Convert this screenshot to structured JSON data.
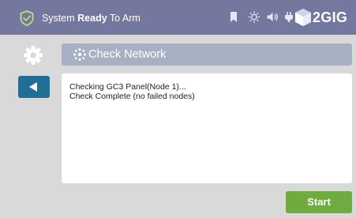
{
  "status_bar": {
    "prefix": "System ",
    "state": "Ready",
    "suffix": " To Arm",
    "icons": [
      "shield-check-icon",
      "bookmark-icon",
      "brightness-icon",
      "volume-icon",
      "power-plug-icon"
    ],
    "logo_text": "2GIG"
  },
  "sidebar": {
    "settings_icon": "gear-icon",
    "back_icon": "back-arrow-icon"
  },
  "page": {
    "title": "Check Network",
    "title_icon": "network-nodes-icon"
  },
  "log": {
    "lines": [
      "Checking GC3 Panel(Node 1)...",
      "Check Complete (no failed nodes)"
    ]
  },
  "actions": {
    "start_label": "Start"
  },
  "colors": {
    "status_bar": "#74789e",
    "title_bar": "#a8b0c3",
    "back_button": "#1f6f96",
    "start_button": "#6fab3e",
    "background": "#d9d9d9"
  }
}
